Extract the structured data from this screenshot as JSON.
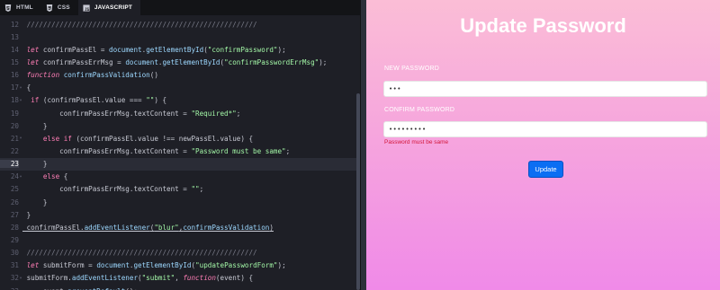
{
  "tabs": [
    {
      "label": "HTML",
      "icon": "html5-icon",
      "active": false
    },
    {
      "label": "CSS",
      "icon": "css3-icon",
      "active": false
    },
    {
      "label": "JAVASCRIPT",
      "icon": "js-icon",
      "active": true
    }
  ],
  "code": {
    "lines": [
      {
        "n": "12",
        "text": "////////////////////////////////////////////////////////"
      },
      {
        "n": "13",
        "text": ""
      },
      {
        "n": "14",
        "text": "let confirmPassEl = document.getElementById(\"confirmPassword\");"
      },
      {
        "n": "15",
        "text": "let confirmPassErrMsg = document.getElementById(\"confirmPasswordErrMsg\");"
      },
      {
        "n": "16",
        "text": "function confirmPassValidation()"
      },
      {
        "n": "17",
        "text": "{"
      },
      {
        "n": "18",
        "text": " if (confirmPassEl.value === \"\") {"
      },
      {
        "n": "19",
        "text": "        confirmPassErrMsg.textContent = \"Required*\";"
      },
      {
        "n": "20",
        "text": "    }"
      },
      {
        "n": "21",
        "text": "    else if (confirmPassEl.value !== newPassEl.value) {"
      },
      {
        "n": "22",
        "text": "        confirmPassErrMsg.textContent = \"Password must be same\";"
      },
      {
        "n": "23",
        "text": "    }"
      },
      {
        "n": "24",
        "text": "    else {"
      },
      {
        "n": "25",
        "text": "        confirmPassErrMsg.textContent = \"\";"
      },
      {
        "n": "26",
        "text": "    }"
      },
      {
        "n": "27",
        "text": "}"
      },
      {
        "n": "28",
        "text": "confirmPassEl.addEventListener(\"blur\",confirmPassValidation)"
      },
      {
        "n": "29",
        "text": ""
      },
      {
        "n": "30",
        "text": "////////////////////////////////////////////////////////"
      },
      {
        "n": "31",
        "text": "let submitForm = document.getElementById(\"updatePasswordForm\");"
      },
      {
        "n": "32",
        "text": "submitForm.addEventListener(\"submit\", function(event) {"
      },
      {
        "n": "33",
        "text": "    event.preventDefault();"
      }
    ],
    "highlighted_line": "23"
  },
  "preview": {
    "title": "Update Password",
    "new_password_label": "NEW PASSWORD",
    "new_password_value": "•••",
    "confirm_password_label": "CONFIRM PASSWORD",
    "confirm_password_value": "•••••••••",
    "error_message": "Password must be same",
    "submit_label": "Update"
  },
  "colors": {
    "accent_button": "#0b6ef3",
    "error_text": "#d3163a",
    "editor_bg": "#1e1f26"
  }
}
